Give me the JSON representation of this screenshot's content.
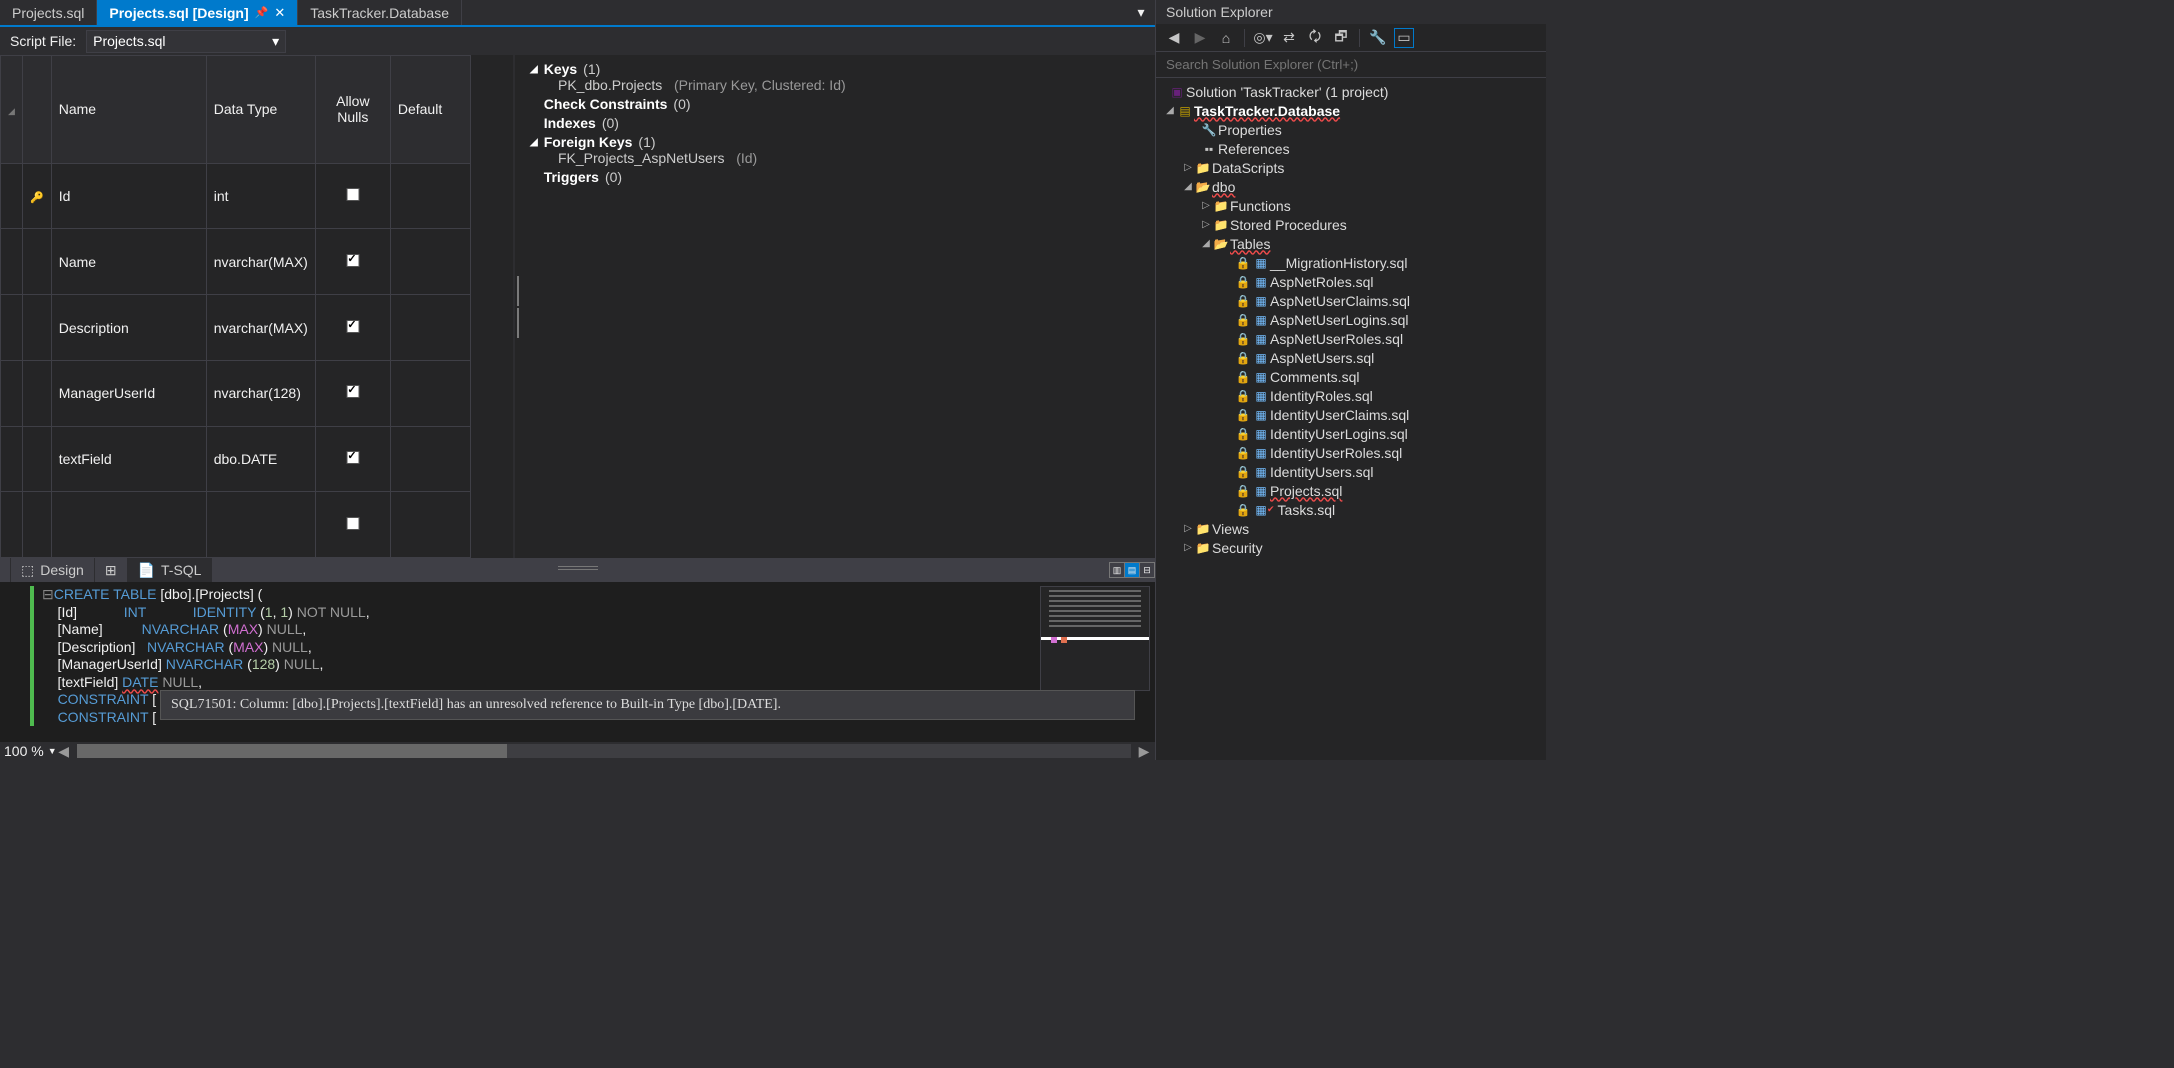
{
  "tabs": {
    "t1": "Projects.sql",
    "t2": "Projects.sql [Design]",
    "t3": "TaskTracker.Database"
  },
  "script_bar": {
    "label": "Script File:",
    "value": "Projects.sql"
  },
  "col_headers": {
    "name": "Name",
    "type": "Data Type",
    "nulls": "Allow Nulls",
    "def": "Default"
  },
  "cols": [
    {
      "pk": true,
      "name": "Id",
      "type": "int",
      "null": false
    },
    {
      "pk": false,
      "name": "Name",
      "type": "nvarchar(MAX)",
      "null": true
    },
    {
      "pk": false,
      "name": "Description",
      "type": "nvarchar(MAX)",
      "null": true
    },
    {
      "pk": false,
      "name": "ManagerUserId",
      "type": "nvarchar(128)",
      "null": true
    },
    {
      "pk": false,
      "name": "textField",
      "type": "dbo.DATE",
      "null": true
    }
  ],
  "meta": {
    "keys": {
      "label": "Keys",
      "count": "(1)",
      "item": "PK_dbo.Projects",
      "detail": "(Primary Key, Clustered: Id)"
    },
    "cc": {
      "label": "Check Constraints",
      "count": "(0)"
    },
    "ix": {
      "label": "Indexes",
      "count": "(0)"
    },
    "fk": {
      "label": "Foreign Keys",
      "count": "(1)",
      "item": "FK_Projects_AspNetUsers",
      "detail": "(Id)"
    },
    "tr": {
      "label": "Triggers",
      "count": "(0)"
    }
  },
  "sub_tabs": {
    "design": "Design",
    "tsql": "T-SQL"
  },
  "sql": {
    "l1a": "CREATE TABLE",
    "l1b": " [dbo].[Projects] (",
    "l2a": "    [Id]            ",
    "l2b": "INT",
    "l2c": "            ",
    "l2d": "IDENTITY",
    "l2e": " (",
    "l2f": "1",
    "l2g": ", ",
    "l2h": "1",
    "l2i": ") ",
    "l2j": "NOT NULL",
    "l2k": ",",
    "l3a": "    [Name]          ",
    "l3b": "NVARCHAR",
    "l3c": " (",
    "l3d": "MAX",
    "l3e": ") ",
    "l3f": "NULL",
    "l3g": ",",
    "l4a": "    [Description]   ",
    "l4b": "NVARCHAR",
    "l4c": " (",
    "l4d": "MAX",
    "l4e": ") ",
    "l4f": "NULL",
    "l4g": ",",
    "l5a": "    [ManagerUserId] ",
    "l5b": "NVARCHAR",
    "l5c": " (",
    "l5d": "128",
    "l5e": ") ",
    "l5f": "NULL",
    "l5g": ",",
    "l6a": "    [textField] ",
    "l6b": "DATE",
    "l6c": " ",
    "l6d": "NULL",
    "l6e": ",",
    "l7a": "    ",
    "l7b": "CONSTRAINT",
    "l7c": " [",
    "l8a": "    ",
    "l8b": "CONSTRAINT",
    "l8c": " ["
  },
  "tooltip": "SQL71501: Column: [dbo].[Projects].[textField] has an unresolved reference to Built-in Type [dbo].[DATE].",
  "zoom": "100 %",
  "se": {
    "title": "Solution Explorer",
    "search": "Search Solution Explorer (Ctrl+;)",
    "sln": "Solution 'TaskTracker' (1 project)",
    "proj": "TaskTracker.Database",
    "props": "Properties",
    "refs": "References",
    "ds": "DataScripts",
    "dbo": "dbo",
    "fn": "Functions",
    "sp": "Stored Procedures",
    "tb": "Tables",
    "files": [
      "__MigrationHistory.sql",
      "AspNetRoles.sql",
      "AspNetUserClaims.sql",
      "AspNetUserLogins.sql",
      "AspNetUserRoles.sql",
      "AspNetUsers.sql",
      "Comments.sql",
      "IdentityRoles.sql",
      "IdentityUserClaims.sql",
      "IdentityUserLogins.sql",
      "IdentityUserRoles.sql",
      "IdentityUsers.sql",
      "Projects.sql",
      "Tasks.sql"
    ],
    "views": "Views",
    "sec": "Security"
  }
}
